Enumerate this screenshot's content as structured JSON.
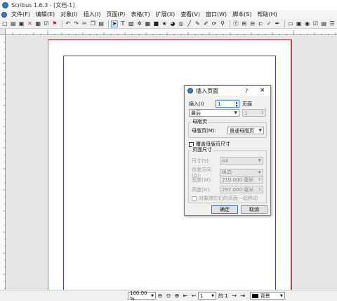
{
  "window": {
    "title": "Scribus 1.6.3 - [文档-1]"
  },
  "menu": [
    "文件(F)",
    "编辑(E)",
    "对象(I)",
    "插入(I)",
    "页面(P)",
    "表格(T)",
    "扩展(X)",
    "查看(V)",
    "窗口(W)",
    "脚本(S)",
    "帮助(H)"
  ],
  "toolbar": {
    "icons": [
      "new-document-icon",
      "open-icon",
      "save-icon",
      "close-icon",
      "print-icon",
      "preflight-icon",
      "pdf-icon",
      "undo-icon",
      "redo-icon",
      "cut-icon",
      "copy-icon",
      "paste-icon",
      "select-icon",
      "text-frame-icon",
      "image-frame-icon",
      "render-frame-icon",
      "table-icon",
      "shape-icon",
      "polygon-icon",
      "arc-icon",
      "spiral-icon",
      "line-icon",
      "bezier-icon",
      "freehand-icon",
      "rotate-icon",
      "zoom-icon",
      "edit-text-icon",
      "link-frames-icon",
      "unlink-frames-icon",
      "measure-icon",
      "copy-properties-icon",
      "eyedropper-icon",
      "preview-icon",
      "edit-mode-icon",
      "pdf-pushbutton-icon",
      "pdf-checkbox-icon",
      "pdf-combobox-icon",
      "pdf-listbox-icon"
    ]
  },
  "statusbar": {
    "zoom": "100.00 %",
    "page_current": "1",
    "page_of": "的 1",
    "layer": "背景"
  },
  "dialog": {
    "title": "插入页面",
    "help": "?",
    "insert_label": "插入(I)",
    "insert_value": "1",
    "pages_label": "页面",
    "position_value": "最后",
    "position_page": "1",
    "master_group": "母版页",
    "master_label": "母版页(M):",
    "master_value": "普通母版页",
    "override_label": "覆盖母版页尺寸",
    "size_group": "页面尺寸",
    "size_label": "尺寸(S):",
    "size_value": "A4",
    "orientation_label": "页面方向(O):",
    "orientation_value": "纵向",
    "width_label": "宽度(W):",
    "width_value": "210.000 毫米",
    "height_label": "高度(H):",
    "height_value": "297.000 毫米",
    "move_objects_label": "对象随它们的页面一起移动",
    "ok_label": "确定",
    "cancel_label": "取消"
  }
}
